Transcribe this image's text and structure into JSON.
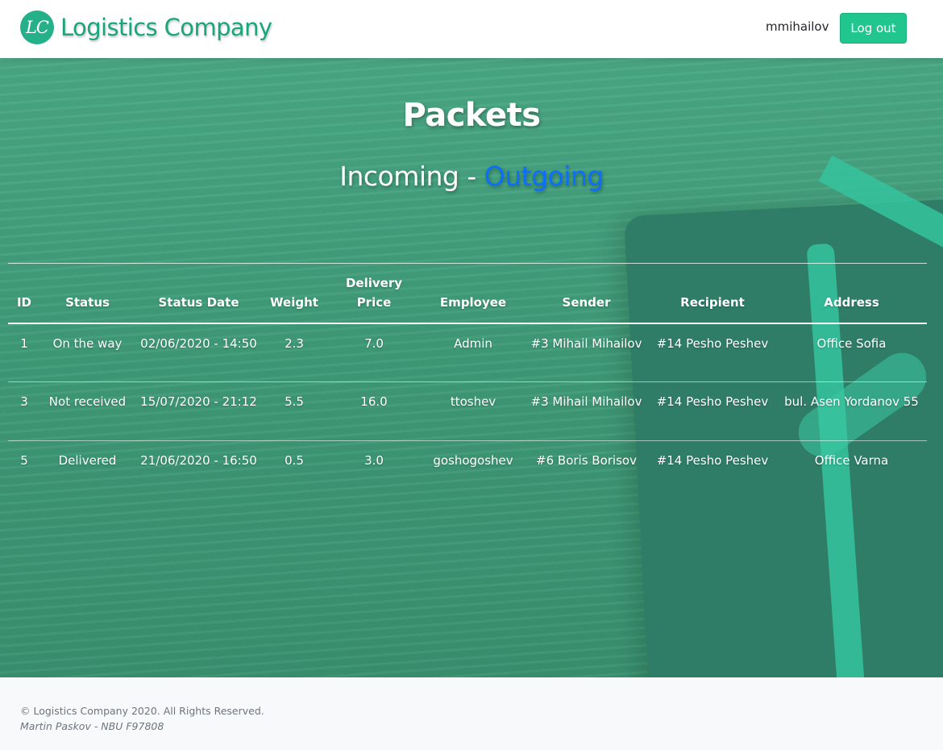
{
  "header": {
    "logo_text": "LC",
    "brand_name": "Logistics Company",
    "username": "mmihailov",
    "logout_label": "Log out"
  },
  "main": {
    "title": "Packets",
    "subnav": {
      "incoming": "Incoming",
      "separator": " - ",
      "outgoing": "Outgoing"
    },
    "table": {
      "columns": [
        "ID",
        "Status",
        "Status Date",
        "Weight",
        "Delivery Price",
        "Employee",
        "Sender",
        "Recipient",
        "Address"
      ],
      "rows": [
        [
          "1",
          "On the way",
          "02/06/2020 - 14:50",
          "2.3",
          "7.0",
          "Admin",
          "#3 Mihail Mihailov",
          "#14 Pesho Peshev",
          "Office Sofia"
        ],
        [
          "3",
          "Not received",
          "15/07/2020 - 21:12",
          "5.5",
          "16.0",
          "ttoshev",
          "#3 Mihail Mihailov",
          "#14 Pesho Peshev",
          "bul. Asen Yordanov 55"
        ],
        [
          "5",
          "Delivered",
          "21/06/2020 - 16:50",
          "0.5",
          "3.0",
          "goshogoshev",
          "#6 Boris Borisov",
          "#14 Pesho Peshev",
          "Office Varna"
        ]
      ]
    }
  },
  "footer": {
    "copyright": "© Logistics Company 2020. All Rights Reserved.",
    "author": "Martin Paskov - NBU F97808"
  },
  "colors": {
    "brand": "#1aa57c",
    "accent_button": "#20c68e",
    "outgoing_link": "#0d6efd",
    "hero_overlay": "#45a381"
  }
}
